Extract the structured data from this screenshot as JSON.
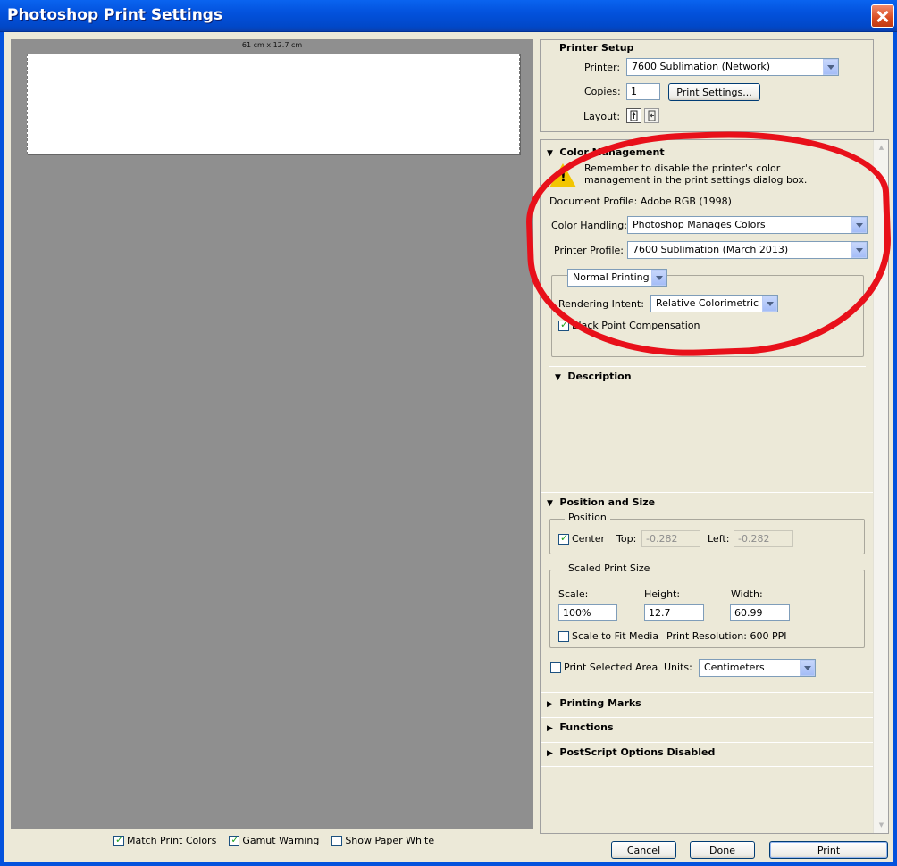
{
  "window": {
    "title": "Photoshop Print Settings"
  },
  "preview": {
    "dimensions": "61 cm x 12.7 cm"
  },
  "bottom": {
    "match_print_colors": "Match Print Colors",
    "gamut_warning": "Gamut Warning",
    "show_paper_white": "Show Paper White"
  },
  "buttons": {
    "cancel": "Cancel",
    "done": "Done",
    "print": "Print"
  },
  "printer_setup": {
    "heading": "Printer Setup",
    "printer_label": "Printer:",
    "printer_value": "7600 Sublimation (Network)",
    "copies_label": "Copies:",
    "copies_value": "1",
    "print_settings_button": "Print Settings...",
    "layout_label": "Layout:"
  },
  "color_management": {
    "heading": "Color Management",
    "warning_line1": "Remember to disable the printer's color",
    "warning_line2": "management in the print settings dialog box.",
    "document_profile": "Document Profile: Adobe RGB (1998)",
    "color_handling_label": "Color Handling:",
    "color_handling_value": "Photoshop Manages Colors",
    "printer_profile_label": "Printer Profile:",
    "printer_profile_value": "7600 Sublimation (March 2013)",
    "printing_mode": "Normal Printing",
    "rendering_intent_label": "Rendering Intent:",
    "rendering_intent_value": "Relative Colorimetric",
    "black_point": "Black Point Compensation"
  },
  "description": {
    "heading": "Description"
  },
  "position_size": {
    "heading": "Position and Size",
    "position_legend": "Position",
    "center_label": "Center",
    "top_label": "Top:",
    "top_value": "-0.282",
    "left_label": "Left:",
    "left_value": "-0.282",
    "scaled_legend": "Scaled Print Size",
    "scale_label": "Scale:",
    "scale_value": "100%",
    "height_label": "Height:",
    "height_value": "12.7",
    "width_label": "Width:",
    "width_value": "60.99",
    "scale_to_fit": "Scale to Fit Media",
    "print_resolution": "Print Resolution: 600 PPI",
    "print_selected_area": "Print Selected Area",
    "units_label": "Units:",
    "units_value": "Centimeters"
  },
  "collapsed_sections": {
    "printing_marks": "Printing Marks",
    "functions": "Functions",
    "postscript": "PostScript Options Disabled"
  },
  "icons": {
    "expanded": "▼",
    "collapsed": "▶"
  },
  "colors": {
    "title_bar": "#0352dd",
    "highlight": "#e8101a",
    "preview_bg": "#8f8f8f"
  }
}
